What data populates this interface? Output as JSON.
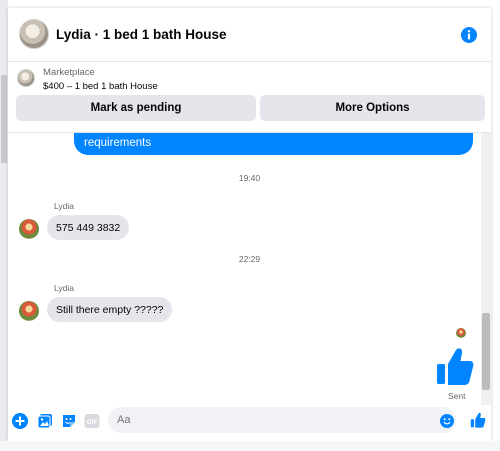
{
  "header": {
    "title": "Lydia · 1 bed 1 bath House",
    "info_icon": "info-icon"
  },
  "listing": {
    "label": "Marketplace",
    "price_title": "$400 – 1 bed 1 bath House",
    "mark_pending_label": "Mark as pending",
    "more_options_label": "More Options"
  },
  "messages": {
    "outgoing_partial": "requirements",
    "items": [
      {
        "timestamp": "19:40",
        "sender": "Lydia",
        "text": "575 449 3832"
      },
      {
        "timestamp": "22:29",
        "sender": "Lydia",
        "text": "Still there empty ?????"
      }
    ],
    "sent_status": "Sent"
  },
  "composer": {
    "placeholder": "Aa",
    "icons": [
      "plus-icon",
      "photo-icon",
      "sticker-icon",
      "gif-icon",
      "emoji-icon",
      "like-icon"
    ],
    "gif_text": "GIF"
  },
  "colors": {
    "accent": "#0084ff",
    "bubble_incoming": "#e4e6eb",
    "muted_text": "#65676b"
  }
}
